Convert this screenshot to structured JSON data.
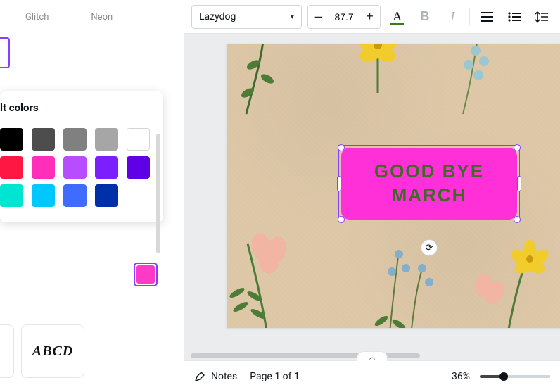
{
  "toolbar": {
    "font_name": "Lazydog",
    "font_size": "87.7",
    "dec_label": "–",
    "inc_label": "+",
    "text_color_letter": "A",
    "bold_letter": "B",
    "italic_letter": "I"
  },
  "left": {
    "tabs": {
      "glitch": "Glitch",
      "neon": "Neon"
    },
    "popover_title": "lt colors",
    "abcd": "ABCD",
    "colors_row1": [
      "#000000",
      "#4d4d4d",
      "#808080",
      "#a6a6a6",
      "#ffffff"
    ],
    "colors_row2": [
      "#ff1744",
      "#ff2fb9",
      "#b84dff",
      "#7c1fff",
      "#5f00e6"
    ],
    "colors_row3": [
      "#00e5d1",
      "#00c8ff",
      "#3f6bff",
      "#0030a8"
    ],
    "selected_color": "#ff3ac6"
  },
  "canvas": {
    "text_line1": "GOOD BYE",
    "text_line2": "MARCH",
    "rotate_icon": "⟳"
  },
  "bottom": {
    "notes_label": "Notes",
    "page_label": "Page 1 of 1",
    "zoom_label": "36%",
    "collapse_icon": "︿"
  }
}
